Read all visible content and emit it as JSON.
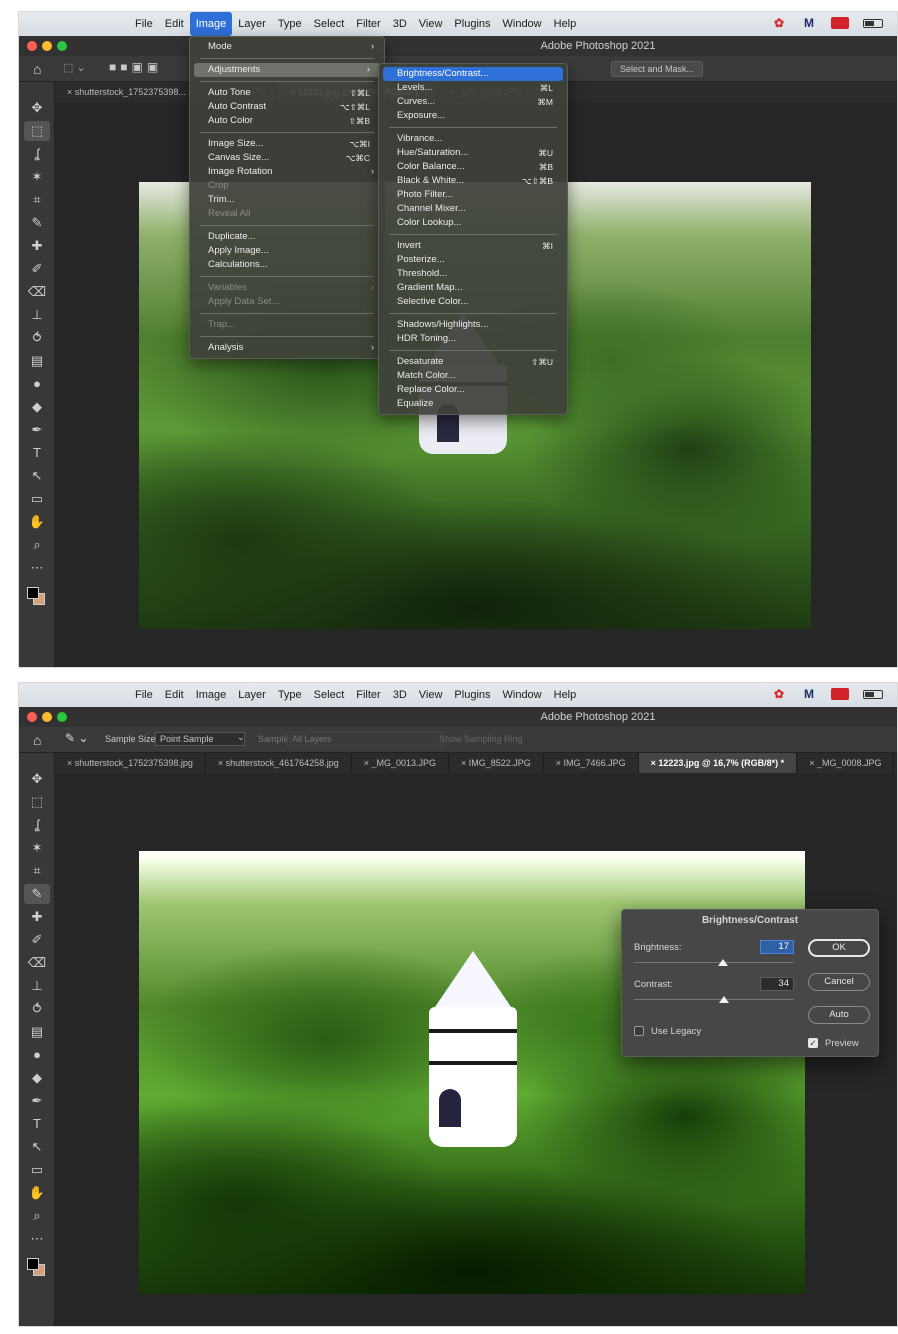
{
  "shot1": {
    "menubar": [
      "File",
      "Edit",
      "Image",
      "Layer",
      "Type",
      "Select",
      "Filter",
      "3D",
      "View",
      "Plugins",
      "Window",
      "Help"
    ],
    "active_menu": "Image",
    "window_title": "Adobe Photoshop 2021",
    "options": {
      "select_and_mask": "Select and Mask..."
    },
    "tabs": [
      {
        "label": "× shutterstock_1752375398..."
      },
      {
        "label": "IG_7466.JPG"
      },
      {
        "label": "× 12223.jpg @ 16,7% (RGB/8*) *"
      },
      {
        "label": "× _MG_0008.JPG"
      }
    ],
    "image_menu": [
      {
        "label": "Mode",
        "shortcut": "",
        "arrow": "›",
        "disabled": false
      },
      {
        "sep": true
      },
      {
        "label": "Adjustments",
        "shortcut": "",
        "arrow": "›",
        "disabled": false,
        "subhl": true
      },
      {
        "sep": true
      },
      {
        "label": "Auto Tone",
        "shortcut": "⇧⌘L",
        "disabled": false
      },
      {
        "label": "Auto Contrast",
        "shortcut": "⌥⇧⌘L",
        "disabled": false
      },
      {
        "label": "Auto Color",
        "shortcut": "⇧⌘B",
        "disabled": false
      },
      {
        "sep": true
      },
      {
        "label": "Image Size...",
        "shortcut": "⌥⌘I",
        "disabled": false
      },
      {
        "label": "Canvas Size...",
        "shortcut": "⌥⌘C",
        "disabled": false
      },
      {
        "label": "Image Rotation",
        "shortcut": "",
        "arrow": "›",
        "disabled": false
      },
      {
        "label": "Crop",
        "shortcut": "",
        "disabled": true
      },
      {
        "label": "Trim...",
        "shortcut": "",
        "disabled": false
      },
      {
        "label": "Reveal All",
        "shortcut": "",
        "disabled": true
      },
      {
        "sep": true
      },
      {
        "label": "Duplicate...",
        "shortcut": "",
        "disabled": false
      },
      {
        "label": "Apply Image...",
        "shortcut": "",
        "disabled": false
      },
      {
        "label": "Calculations...",
        "shortcut": "",
        "disabled": false
      },
      {
        "sep": true
      },
      {
        "label": "Variables",
        "shortcut": "",
        "arrow": "›",
        "disabled": true
      },
      {
        "label": "Apply Data Set...",
        "shortcut": "",
        "disabled": true
      },
      {
        "sep": true
      },
      {
        "label": "Trap...",
        "shortcut": "",
        "disabled": true
      },
      {
        "sep": true
      },
      {
        "label": "Analysis",
        "shortcut": "",
        "arrow": "›",
        "disabled": false
      }
    ],
    "adjustments_menu": [
      {
        "label": "Brightness/Contrast...",
        "shortcut": "",
        "highlight": true
      },
      {
        "label": "Levels...",
        "shortcut": "⌘L"
      },
      {
        "label": "Curves...",
        "shortcut": "⌘M"
      },
      {
        "label": "Exposure...",
        "shortcut": ""
      },
      {
        "sep": true
      },
      {
        "label": "Vibrance...",
        "shortcut": ""
      },
      {
        "label": "Hue/Saturation...",
        "shortcut": "⌘U"
      },
      {
        "label": "Color Balance...",
        "shortcut": "⌘B"
      },
      {
        "label": "Black & White...",
        "shortcut": "⌥⇧⌘B"
      },
      {
        "label": "Photo Filter...",
        "shortcut": ""
      },
      {
        "label": "Channel Mixer...",
        "shortcut": ""
      },
      {
        "label": "Color Lookup...",
        "shortcut": ""
      },
      {
        "sep": true
      },
      {
        "label": "Invert",
        "shortcut": "⌘I"
      },
      {
        "label": "Posterize...",
        "shortcut": ""
      },
      {
        "label": "Threshold...",
        "shortcut": ""
      },
      {
        "label": "Gradient Map...",
        "shortcut": ""
      },
      {
        "label": "Selective Color...",
        "shortcut": ""
      },
      {
        "sep": true
      },
      {
        "label": "Shadows/Highlights...",
        "shortcut": ""
      },
      {
        "label": "HDR Toning...",
        "shortcut": ""
      },
      {
        "sep": true
      },
      {
        "label": "Desaturate",
        "shortcut": "⇧⌘U"
      },
      {
        "label": "Match Color...",
        "shortcut": ""
      },
      {
        "label": "Replace Color...",
        "shortcut": ""
      },
      {
        "label": "Equalize",
        "shortcut": ""
      }
    ]
  },
  "shot2": {
    "menubar": [
      "File",
      "Edit",
      "Image",
      "Layer",
      "Type",
      "Select",
      "Filter",
      "3D",
      "View",
      "Plugins",
      "Window",
      "Help"
    ],
    "window_title": "Adobe Photoshop 2021",
    "options": {
      "sample_size_label": "Sample Size:",
      "sample_size_value": "Point Sample",
      "sample_label": "Sample:",
      "sample_value": "All Layers",
      "show_ring": "Show Sampling Ring"
    },
    "tabs": [
      {
        "label": "× shutterstock_1752375398.jpg"
      },
      {
        "label": "× shutterstock_461764258.jpg"
      },
      {
        "label": "× _MG_0013.JPG"
      },
      {
        "label": "× IMG_8522.JPG"
      },
      {
        "label": "× IMG_7466.JPG"
      },
      {
        "label": "× 12223.jpg @ 16,7% (RGB/8*) *"
      },
      {
        "label": "× _MG_0008.JPG"
      }
    ],
    "dialog": {
      "title": "Brightness/Contrast",
      "brightness_label": "Brightness:",
      "brightness_value": "17",
      "contrast_label": "Contrast:",
      "contrast_value": "34",
      "use_legacy": "Use Legacy",
      "use_legacy_checked": false,
      "preview": "Preview",
      "preview_checked": true,
      "ok": "OK",
      "cancel": "Cancel",
      "auto": "Auto"
    }
  },
  "colors": {
    "accent": "#2f6fd8",
    "traffic_red": "#ff5f57",
    "traffic_yellow": "#febc2e",
    "traffic_green": "#28c840"
  },
  "icons": [
    "move-icon",
    "marquee-icon",
    "lasso-icon",
    "magic-wand-icon",
    "crop-icon",
    "eyedropper-icon",
    "healing-icon",
    "brush-icon",
    "eraser-icon",
    "clone-stamp-icon",
    "history-brush-icon",
    "gradient-icon",
    "blur-icon",
    "dodge-icon",
    "pen-icon",
    "type-icon",
    "path-select-icon",
    "shape-icon",
    "hand-icon",
    "zoom-icon",
    "more-icon"
  ]
}
